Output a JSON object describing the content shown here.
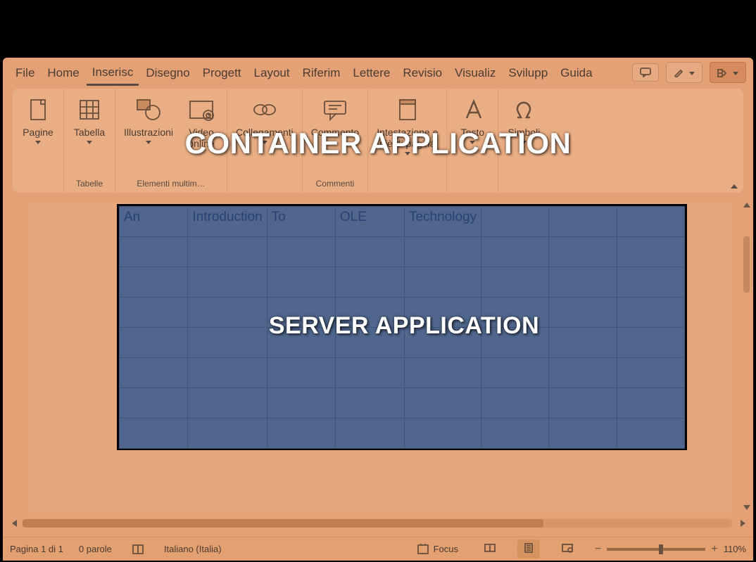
{
  "overlays": {
    "container_label": "CONTAINER APPLICATION",
    "server_label": "SERVER APPLICATION"
  },
  "tabs": {
    "items": [
      "File",
      "Home",
      "Inserisci",
      "Disegno",
      "Progettazione",
      "Layout",
      "Riferimenti",
      "Lettere",
      "Revisione",
      "Visualizza",
      "Sviluppo",
      "Guida"
    ],
    "display": [
      "File",
      "Home",
      "Inserisc",
      "Disegno",
      "Progett",
      "Layout",
      "Riferim",
      "Lettere",
      "Revisio",
      "Visualiz",
      "Svilupp",
      "Guida"
    ],
    "active_index": 2,
    "comments_btn": "Commenti",
    "editing_btn": "Modifica",
    "share_btn": "Condividi"
  },
  "ribbon": {
    "groups": [
      {
        "label": "",
        "commands": [
          {
            "name": "pagine",
            "label": "Pagine",
            "dropdown": true,
            "icon": "page-icon"
          }
        ]
      },
      {
        "label": "Tabelle",
        "commands": [
          {
            "name": "tabella",
            "label": "Tabella",
            "dropdown": true,
            "icon": "table-icon"
          }
        ]
      },
      {
        "label": "Elementi multim…",
        "commands": [
          {
            "name": "illustrazioni",
            "label": "Illustrazioni",
            "dropdown": true,
            "icon": "shapes-icon"
          },
          {
            "name": "video-online",
            "label": "Video\nonline",
            "dropdown": false,
            "icon": "video-icon"
          }
        ]
      },
      {
        "label": "",
        "commands": [
          {
            "name": "collegamenti",
            "label": "Collegamenti",
            "dropdown": true,
            "icon": "link-icon"
          }
        ]
      },
      {
        "label": "Commenti",
        "commands": [
          {
            "name": "commento",
            "label": "Commento",
            "dropdown": false,
            "icon": "comment-icon"
          }
        ]
      },
      {
        "label": "",
        "commands": [
          {
            "name": "intestazione",
            "label": "Intestazione e\npiè di pagina",
            "dropdown": true,
            "icon": "header-icon"
          }
        ]
      },
      {
        "label": "",
        "commands": [
          {
            "name": "testo",
            "label": "Testo",
            "dropdown": true,
            "icon": "text-icon"
          }
        ]
      },
      {
        "label": "",
        "commands": [
          {
            "name": "simboli",
            "label": "Simboli",
            "dropdown": true,
            "icon": "omega-icon"
          }
        ]
      }
    ]
  },
  "embedded": {
    "rows": 8,
    "cols": 8,
    "header": [
      "An",
      "Introduction",
      "To",
      "OLE",
      "Technology",
      "",
      "",
      ""
    ]
  },
  "status": {
    "page": "Pagina 1 di 1",
    "words": "0 parole",
    "language": "Italiano (Italia)",
    "focus": "Focus",
    "zoom": "110%"
  }
}
